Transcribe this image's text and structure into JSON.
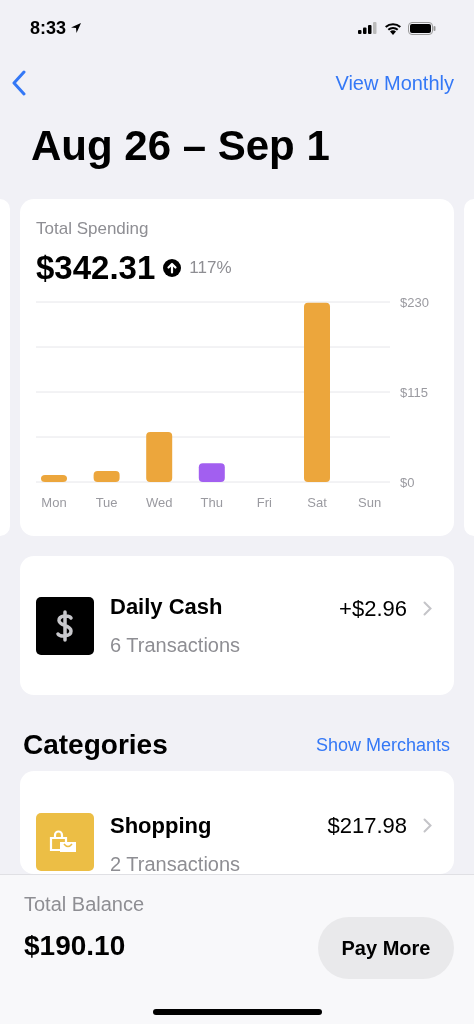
{
  "status_bar": {
    "time": "8:33"
  },
  "nav": {
    "action": "View Monthly"
  },
  "title": "Aug 26 – Sep 1",
  "spending_card": {
    "label": "Total Spending",
    "amount": "$342.31",
    "change": "117%",
    "chart_data": {
      "type": "bar",
      "categories": [
        "Mon",
        "Tue",
        "Wed",
        "Thu",
        "Fri",
        "Sat",
        "Sun"
      ],
      "series": [
        {
          "color": "#eca63c",
          "values": [
            9,
            14,
            64,
            null,
            null,
            229,
            null
          ]
        },
        {
          "color": "#a25ff0",
          "values": [
            null,
            null,
            null,
            24,
            null,
            null,
            null
          ]
        }
      ],
      "ylim": [
        0,
        230
      ],
      "yticks": [
        {
          "value": 0,
          "label": "$0"
        },
        {
          "value": 115,
          "label": "$115"
        },
        {
          "value": 230,
          "label": "$230"
        }
      ]
    }
  },
  "daily_cash": {
    "title": "Daily Cash",
    "subtitle": "6 Transactions",
    "amount": "+$2.96"
  },
  "categories": {
    "heading": "Categories",
    "action": "Show Merchants",
    "items": [
      {
        "kind": "shopping",
        "title": "Shopping",
        "subtitle": "2 Transactions",
        "amount": "$217.98"
      }
    ]
  },
  "footer": {
    "label": "Total Balance",
    "amount": "$190.10",
    "button": "Pay More"
  }
}
